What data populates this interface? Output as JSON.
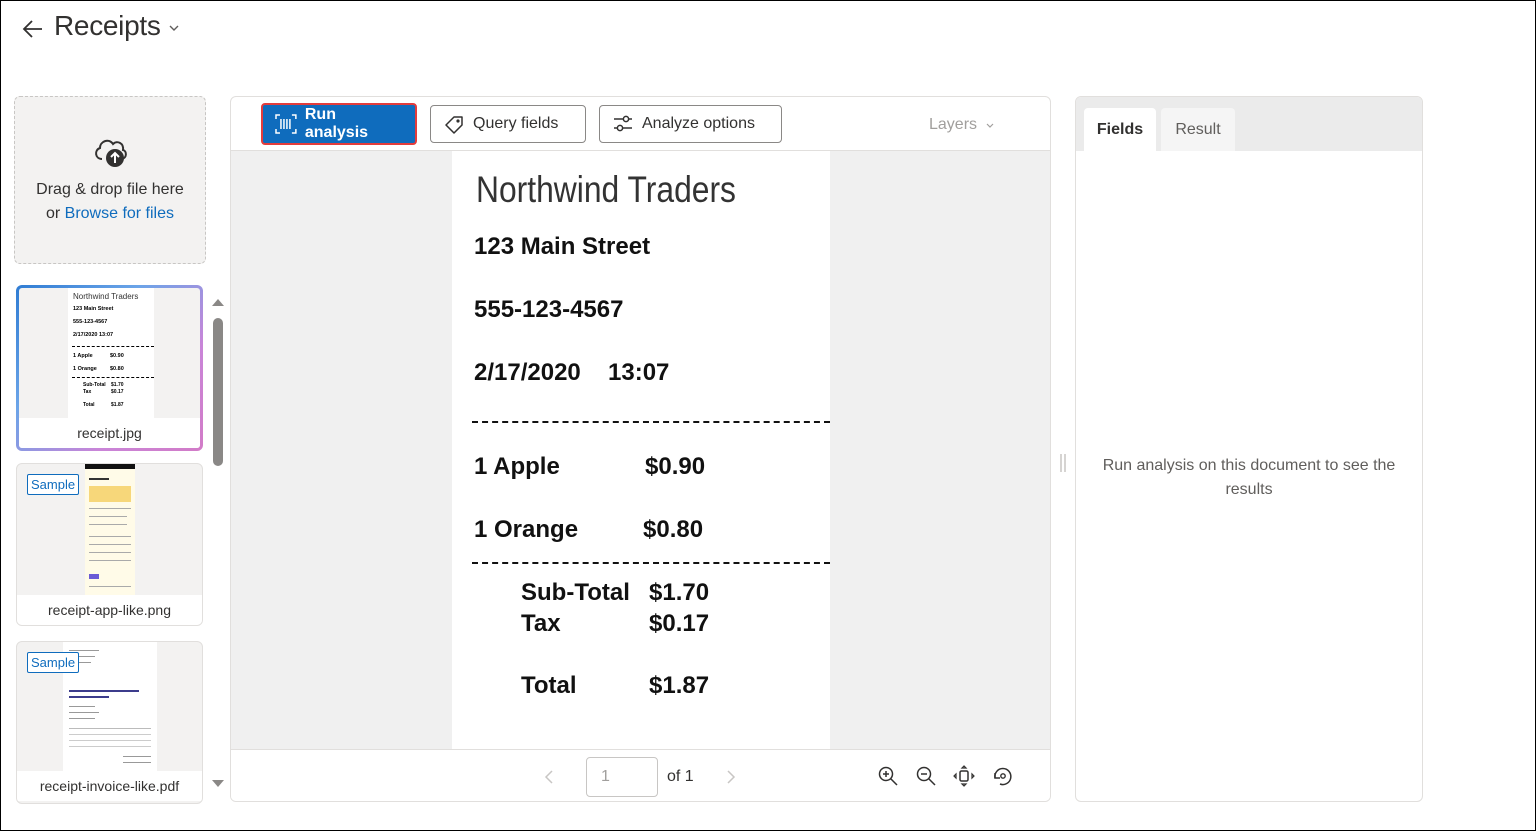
{
  "header": {
    "title": "Receipts"
  },
  "upload": {
    "line1": "Drag & drop file here",
    "line2_prefix": "or ",
    "browse_link": "Browse for files"
  },
  "files": [
    {
      "name": "receipt.jpg",
      "selected": true,
      "sample": false
    },
    {
      "name": "receipt-app-like.png",
      "selected": false,
      "sample": true,
      "badge": "Sample"
    },
    {
      "name": "receipt-invoice-like.pdf",
      "selected": false,
      "sample": true,
      "badge": "Sample"
    }
  ],
  "thumb_receipt": {
    "title": "Northwind Traders",
    "street": "123 Main Street",
    "phone": "555-123-4567",
    "datetime": "2/17/2020  13:07",
    "item1": "1 Apple",
    "item1_price": "$0.90",
    "item2": "1 Orange",
    "item2_price": "$0.80",
    "subtotal_label": "Sub-Total",
    "subtotal": "$1.70",
    "tax_label": "Tax",
    "tax": "$0.17",
    "total_label": "Total",
    "total": "$1.87"
  },
  "toolbar": {
    "run_analysis": "Run analysis",
    "query_fields": "Query fields",
    "analyze_options": "Analyze options",
    "layers": "Layers"
  },
  "receipt": {
    "store": "Northwind Traders",
    "street": "123 Main Street",
    "phone": "555-123-4567",
    "date": "2/17/2020",
    "time": "13:07",
    "items": [
      {
        "label": "1 Apple",
        "price": "$0.90"
      },
      {
        "label": "1 Orange",
        "price": "$0.80"
      }
    ],
    "subtotal_label": "Sub-Total",
    "subtotal": "$1.70",
    "tax_label": "Tax",
    "tax": "$0.17",
    "total_label": "Total",
    "total": "$1.87"
  },
  "pager": {
    "current_page": "1",
    "of_label": "of 1"
  },
  "results": {
    "tabs": [
      "Fields",
      "Result"
    ],
    "active_tab": "Fields",
    "empty_message": "Run analysis on this document to see the results"
  },
  "colors": {
    "accent": "#0f6cbd",
    "highlight_border": "#e33c3c"
  },
  "icons": [
    "back-arrow-icon",
    "chevron-down-icon",
    "cloud-upload-icon",
    "barcode-scan-icon",
    "tag-icon",
    "sliders-icon",
    "zoom-in-icon",
    "zoom-out-icon",
    "fit-page-icon",
    "rotate-icon"
  ]
}
